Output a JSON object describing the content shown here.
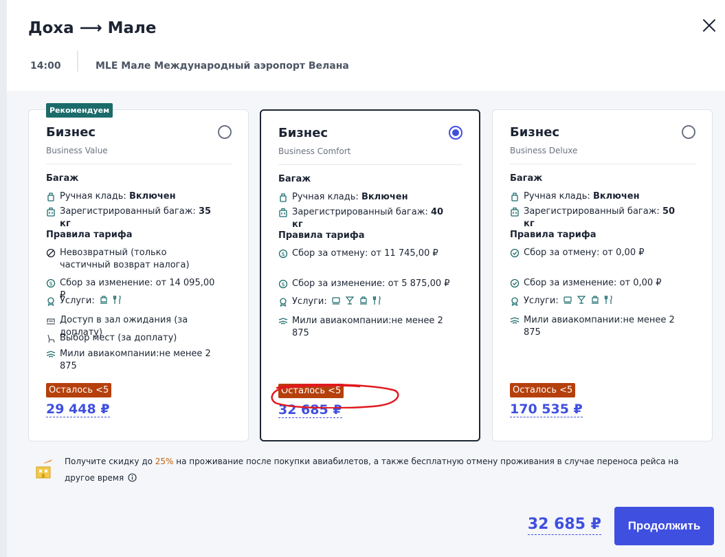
{
  "title": "Доха ⟶ Мале",
  "route_info": {
    "time": "14:00",
    "airport": "MLE Мале Международный аэропорт Велана"
  },
  "tariffs": [
    {
      "badge": "Рекомендуем",
      "title": "Бизнес",
      "subtitle": "Business Value",
      "selected": false,
      "baggage_heading": "Багаж",
      "carry_on_label": "Ручная кладь:",
      "carry_on_value": "Включен",
      "checked_label": "Зарегистрированный багаж:",
      "checked_value": "35 кг",
      "rules_heading": "Правила тарифа",
      "rules": {
        "refund": "Невозвратный (только частичный возврат налога)",
        "change": "Сбор за изменение: от 14 095,00 ₽",
        "services_label": "Услуги:",
        "lounge": "Доступ в зал ожидания (за доплату)",
        "seats": "Выбор мест (за доплату)",
        "miles": "Мили авиакомпании:не менее 2 875"
      },
      "services_icons": [
        "luggage-cart-icon",
        "meal-icon"
      ],
      "availability": "Осталось <5",
      "price": "29 448 ₽"
    },
    {
      "title": "Бизнес",
      "subtitle": "Business Comfort",
      "selected": true,
      "baggage_heading": "Багаж",
      "carry_on_label": "Ручная кладь:",
      "carry_on_value": "Включен",
      "checked_label": "Зарегистрированный багаж:",
      "checked_value": "40 кг",
      "rules_heading": "Правила тарифа",
      "rules": {
        "cancel": "Сбор за отмену: от 11 745,00 ₽",
        "change": "Сбор за изменение: от 5 875,00 ₽",
        "services_label": "Услуги:",
        "miles": "Мили авиакомпании:не менее 2 875"
      },
      "services_icons": [
        "seat-icon",
        "drink-icon",
        "luggage-cart-icon",
        "meal-icon"
      ],
      "availability": "Осталось <5",
      "price": "32 685 ₽"
    },
    {
      "title": "Бизнес",
      "subtitle": "Business Deluxe",
      "selected": false,
      "baggage_heading": "Багаж",
      "carry_on_label": "Ручная кладь:",
      "carry_on_value": "Включен",
      "checked_label": "Зарегистрированный багаж:",
      "checked_value": "50 кг",
      "rules_heading": "Правила тарифа",
      "rules": {
        "cancel": "Сбор за отмену: от 0,00 ₽",
        "change": "Сбор за изменение: от 0,00 ₽",
        "services_label": "Услуги:",
        "miles": "Мили авиакомпании:не менее 2 875"
      },
      "services_icons": [
        "seat-icon",
        "drink-icon",
        "luggage-cart-icon",
        "meal-icon"
      ],
      "availability": "Осталось <5",
      "price": "170 535 ₽"
    }
  ],
  "promo": {
    "text_before": "Получите скидку до ",
    "percent": "25%",
    "text_after": " на проживание после покупки авиабилетов, а также бесплатную отмену проживания в случае переноса рейса на другое время"
  },
  "footer": {
    "total": "32 685 ₽",
    "continue_label": "Продолжить"
  },
  "colors": {
    "accent": "#3f4fe0",
    "badge": "#1b6b6a",
    "availability": "#b5400c",
    "annotation": "#e0191f"
  }
}
